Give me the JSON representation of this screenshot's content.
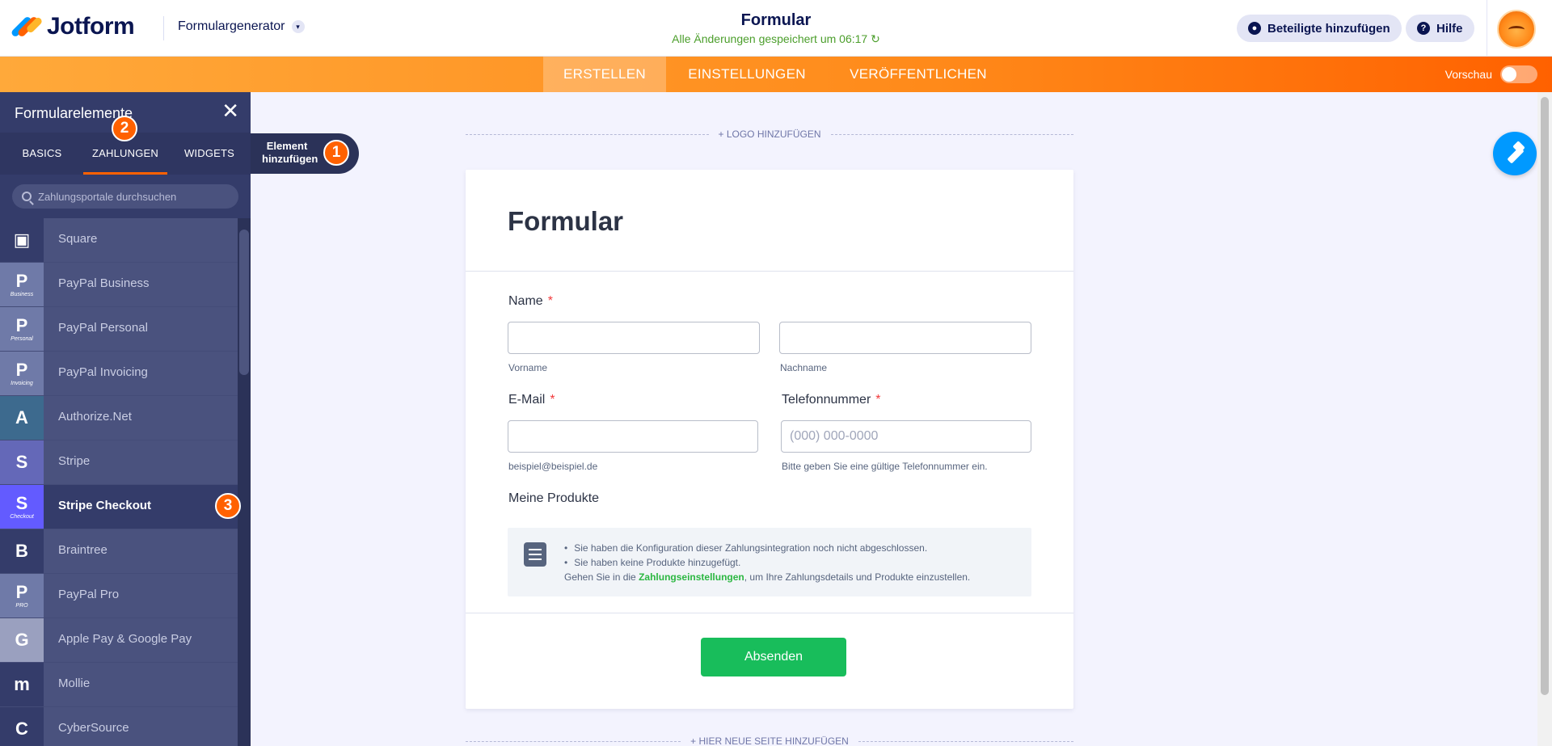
{
  "app": {
    "logo_text": "Jotform",
    "form_generator": "Formulargenerator",
    "form_title": "Formular",
    "saved_status": "Alle Änderungen gespeichert um 06:17",
    "add_participants": "Beteiligte hinzufügen",
    "help": "Hilfe"
  },
  "nav": {
    "tabs": [
      "ERSTELLEN",
      "EINSTELLUNGEN",
      "VERÖFFENTLICHEN"
    ],
    "preview_label": "Vorschau"
  },
  "panel": {
    "title": "Formularelemente",
    "tabs": [
      "BASICS",
      "ZAHLUNGEN",
      "WIDGETS"
    ],
    "search_placeholder": "Zahlungsportale durchsuchen",
    "items": [
      {
        "label": "Square",
        "glyph": "▣",
        "sub": "",
        "bg": "#343c6a"
      },
      {
        "label": "PayPal Business",
        "glyph": "P",
        "sub": "Business",
        "bg": "#6f7aa8"
      },
      {
        "label": "PayPal Personal",
        "glyph": "P",
        "sub": "Personal",
        "bg": "#6f7aa8"
      },
      {
        "label": "PayPal Invoicing",
        "glyph": "P",
        "sub": "Invoicing",
        "bg": "#6f7aa8"
      },
      {
        "label": "Authorize.Net",
        "glyph": "A",
        "sub": "",
        "bg": "#3d6a8e"
      },
      {
        "label": "Stripe",
        "glyph": "S",
        "sub": "",
        "bg": "#6468b8"
      },
      {
        "label": "Stripe Checkout",
        "glyph": "S",
        "sub": "Checkout",
        "bg": "#635bff"
      },
      {
        "label": "Braintree",
        "glyph": "B",
        "sub": "",
        "bg": "#343c6a"
      },
      {
        "label": "PayPal Pro",
        "glyph": "P",
        "sub": "PRO",
        "bg": "#6f7aa8"
      },
      {
        "label": "Apple Pay & Google Pay",
        "glyph": "G",
        "sub": "",
        "bg": "#9aa0bf"
      },
      {
        "label": "Mollie",
        "glyph": "m",
        "sub": "",
        "bg": "#343c6a"
      },
      {
        "label": "CyberSource",
        "glyph": "C",
        "sub": "",
        "bg": "#343c6a"
      }
    ]
  },
  "callouts": {
    "add_element": "Element hinzufügen",
    "step1": "1",
    "step2": "2",
    "step3": "3"
  },
  "canvas": {
    "add_logo": "+ LOGO HINZUFÜGEN",
    "add_page": "+ HIER NEUE SEITE HINZUFÜGEN",
    "heading": "Formular",
    "name_label": "Name",
    "first_name_sub": "Vorname",
    "last_name_sub": "Nachname",
    "email_label": "E-Mail",
    "email_sub": "beispiel@beispiel.de",
    "phone_label": "Telefonnummer",
    "phone_placeholder": "(000) 000-0000",
    "phone_sub": "Bitte geben Sie eine gültige Telefonnummer ein.",
    "products_label": "Meine Produkte",
    "note_line1": "Sie haben die Konfiguration dieser Zahlungsintegration noch nicht abgeschlossen.",
    "note_line2": "Sie haben keine Produkte hinzugefügt.",
    "note_go_prefix": "Gehen Sie in die",
    "note_go_link": "Zahlungseinstellungen",
    "note_go_suffix": ", um Ihre Zahlungsdetails und Produkte einzustellen.",
    "required_mark": "*",
    "submit": "Absenden"
  },
  "colors": {
    "accent": "#ff6100",
    "panel": "#343c6a",
    "submit": "#18bd5b",
    "fab": "#0099ff"
  }
}
